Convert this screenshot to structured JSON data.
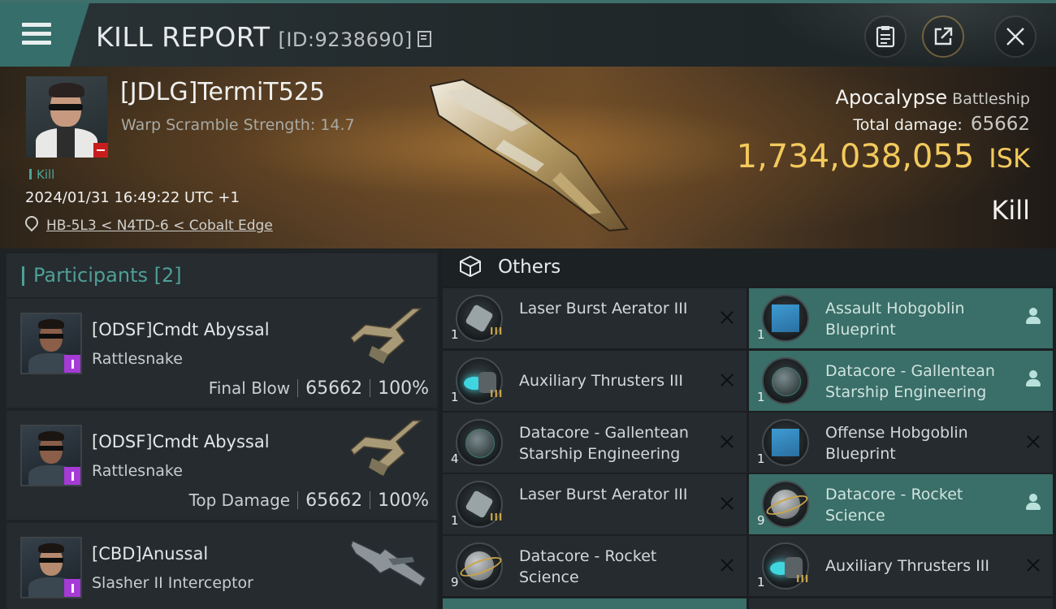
{
  "header": {
    "title": "KILL REPORT",
    "report_id": "[ID:9238690]",
    "icons": [
      "menu-icon",
      "copy-icon",
      "clipboard-icon",
      "share-icon",
      "close-icon"
    ]
  },
  "victim": {
    "name": "[JDLG]TermiT525",
    "scramble": "Warp Scramble Strength: 14.7",
    "kill_tag": "Kill",
    "timestamp": "2024/01/31 16:49:22 UTC +1",
    "location": "HB-5L3 < N4TD-6 < Cobalt Edge",
    "ship_name": "Apocalypse",
    "ship_class": "Battleship",
    "damage_label": "Total damage:",
    "damage_value": "65662",
    "isk_value": "1,734,038,055",
    "isk_unit": "ISK",
    "result": "Kill"
  },
  "participants": {
    "title": "Participants [2]",
    "items": [
      {
        "name": "[ODSF]Cmdt Abyssal",
        "ship": "Rattlesnake",
        "role": "Final Blow",
        "damage": "65662",
        "percent": "100%"
      },
      {
        "name": "[ODSF]Cmdt Abyssal",
        "ship": "Rattlesnake",
        "role": "Top Damage",
        "damage": "65662",
        "percent": "100%"
      },
      {
        "name": "[CBD]Anussal",
        "ship": "Slasher II Interceptor"
      }
    ]
  },
  "others": {
    "title": "Others",
    "left": [
      {
        "name": "Laser Burst Aerator III",
        "qty": "1",
        "tier": "III",
        "status": "destroyed"
      },
      {
        "name": "Auxiliary Thrusters III",
        "qty": "1",
        "tier": "III",
        "status": "destroyed"
      },
      {
        "name": "Datacore - Gallentean Starship Engineering",
        "qty": "4",
        "tier": "",
        "status": "destroyed"
      },
      {
        "name": "Laser Burst Aerator III",
        "qty": "1",
        "tier": "III",
        "status": "destroyed"
      },
      {
        "name": "Datacore - Rocket Science",
        "qty": "9",
        "tier": "",
        "status": "destroyed"
      }
    ],
    "right": [
      {
        "name": "Assault Hobgoblin Blueprint",
        "qty": "1",
        "tier": "",
        "status": "dropped"
      },
      {
        "name": "Datacore - Gallentean Starship Engineering",
        "qty": "1",
        "tier": "",
        "status": "dropped"
      },
      {
        "name": "Offense Hobgoblin Blueprint",
        "qty": "1",
        "tier": "",
        "status": "destroyed"
      },
      {
        "name": "Datacore - Rocket Science",
        "qty": "9",
        "tier": "",
        "status": "dropped"
      },
      {
        "name": "Auxiliary Thrusters III",
        "qty": "1",
        "tier": "III",
        "status": "destroyed"
      }
    ]
  },
  "colors": {
    "accent_teal": "#356e6a",
    "isk_gold": "#f2c95c",
    "dropped_bg": "#3a6e68",
    "destroyed_bg": "#262b2f"
  }
}
